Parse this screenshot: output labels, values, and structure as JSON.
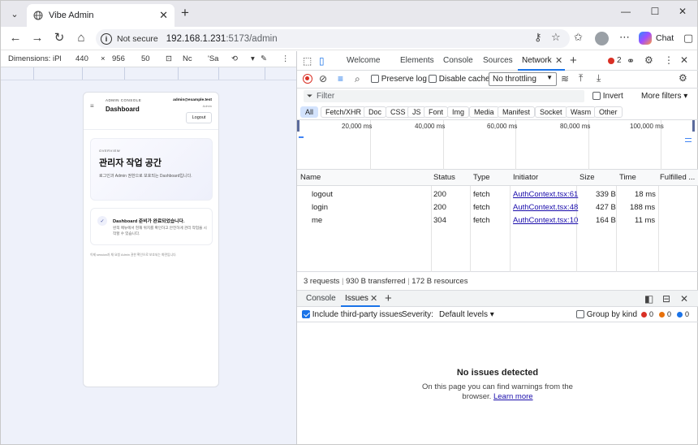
{
  "browser": {
    "tab_title": "Vibe Admin",
    "url_security": "Not secure",
    "url_host": "192.168.1.231",
    "url_path": ":5173/admin",
    "chat_label": "Chat"
  },
  "device_toolbar": {
    "dimensions_label": "Dimensions:",
    "device": "iPl",
    "width": "440",
    "times": "×",
    "height": "956",
    "zoom": "50",
    "throttle": "Nc",
    "mode": "'Sa"
  },
  "app": {
    "kicker": "ADMIN CONSOLE",
    "title": "Dashboard",
    "email": "admin@example.test",
    "role": "Admin",
    "logout": "Logout",
    "overview_kicker": "OVERVIEW",
    "overview_heading": "관리자 작업 공간",
    "overview_desc": "로그인과 Admin 권한으로 보호되는 Dashboard입니다.",
    "status_title": "Dashboard 준비가 완료되었습니다.",
    "status_desc": "왼쪽 메뉴에서 현재 위치를 확인하고 안전하게 관리 작업을 시작할 수 있습니다.",
    "footer": "이제 session과 채 요청 Admin 권한 확인으로 보호되는 화면입니다."
  },
  "devtools": {
    "tabs": [
      "Welcome",
      "Elements",
      "Console",
      "Sources",
      "Network"
    ],
    "error_count": "2",
    "network_toolbar": {
      "preserve_log": "Preserve log",
      "disable_cache": "Disable cache",
      "throttling": "No throttling"
    },
    "filter_placeholder": "Filter",
    "invert": "Invert",
    "more_filters": "More filters",
    "type_filters": [
      "All",
      "Fetch/XHR",
      "Doc",
      "CSS",
      "JS",
      "Font",
      "Img",
      "Media",
      "Manifest",
      "Socket",
      "Wasm",
      "Other"
    ],
    "timeline_ticks": [
      "20,000 ms",
      "40,000 ms",
      "60,000 ms",
      "80,000 ms",
      "100,000 ms"
    ],
    "columns": [
      "Name",
      "Status",
      "Type",
      "Initiator",
      "Size",
      "Time",
      "Fulfilled ..."
    ],
    "requests": [
      {
        "name": "logout",
        "status": "200",
        "type": "fetch",
        "initiator": "AuthContext.tsx:61",
        "size": "339 B",
        "time": "18 ms"
      },
      {
        "name": "login",
        "status": "200",
        "type": "fetch",
        "initiator": "AuthContext.tsx:48",
        "size": "427 B",
        "time": "188 ms"
      },
      {
        "name": "me",
        "status": "304",
        "type": "fetch",
        "initiator": "AuthContext.tsx:10",
        "size": "164 B",
        "time": "11 ms"
      }
    ],
    "summary": {
      "requests": "3 requests",
      "transferred": "930 B transferred",
      "resources": "172 B resources"
    },
    "drawer": {
      "tabs": [
        "Console",
        "Issues"
      ],
      "include_third_party": "Include third-party issues",
      "severity_label": "Severity:",
      "severity_value": "Default levels",
      "group_by_kind": "Group by kind",
      "counts": [
        "0",
        "0",
        "0"
      ],
      "count_colors": [
        "#d93025",
        "#e8710a",
        "#1a73e8"
      ],
      "empty_title": "No issues detected",
      "empty_desc": "On this page you can find warnings from the browser.",
      "learn_more": "Learn more"
    }
  }
}
